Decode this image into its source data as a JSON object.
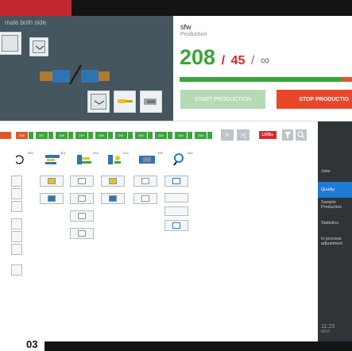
{
  "left_panel": {
    "title": "male both side"
  },
  "job": {
    "name": "sfw",
    "subtitle": "Production",
    "count": "208",
    "slash1": "/",
    "target": "45",
    "slash2": "/",
    "infinity": "∞"
  },
  "progress": {
    "fraction": 0.94
  },
  "buttons": {
    "start": "START PRODUCTION",
    "stop": "STOP PRODUCTIO"
  },
  "toolbar": {
    "steps": [
      "256",
      "257",
      "258",
      "259",
      "260",
      "261",
      "262",
      "263",
      "264",
      "265"
    ],
    "live": "LIVE●",
    "next_glyph": ">",
    "last_glyph": ">|"
  },
  "columns": {
    "nums": [
      "302",
      "301",
      "214",
      "212",
      "205",
      "202"
    ]
  },
  "sidebar": {
    "jobs": "Jobs",
    "quality": "Quality",
    "sample": "Sample Production",
    "statistics": "Statistics",
    "inprocess": "In process adjustment",
    "time": "11:23",
    "date": "6/07/"
  },
  "footer": {
    "page": "03"
  },
  "colors": {
    "green": "#3aa53a",
    "red": "#e1262a",
    "blue": "#1f7ad6"
  }
}
